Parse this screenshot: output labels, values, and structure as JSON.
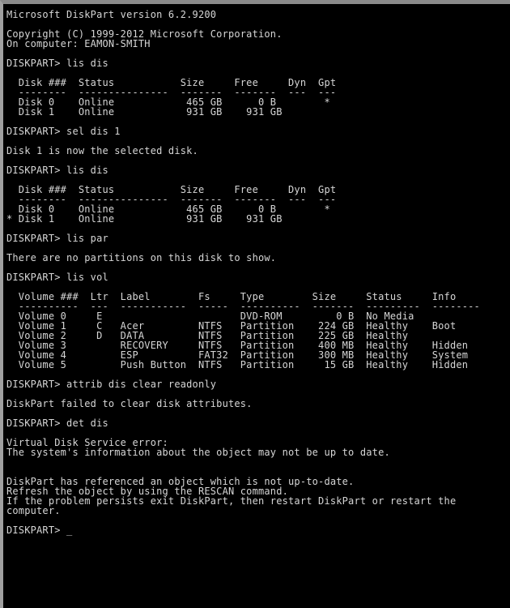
{
  "window": {
    "app_name": "DiskPart",
    "border_top_color": "#8a8a8a",
    "border_left_color": "#a0a0a0",
    "background_color": "#000000",
    "text_color": "#d6d6d6"
  },
  "console": {
    "prompt": "DISKPART>",
    "cursor": "_",
    "header": {
      "version_line": "Microsoft DiskPart version 6.2.9200",
      "copyright_line": "Copyright (C) 1999-2012 Microsoft Corporation.",
      "computer_line": "On computer: EAMON-SMITH"
    },
    "commands": {
      "list_disk": "lis dis",
      "select_disk": "sel dis 1",
      "list_partition": "lis par",
      "list_volume": "lis vol",
      "attrib_disk": "attrib dis clear readonly",
      "detail_disk": "det dis"
    },
    "messages": {
      "disk_selected": "Disk 1 is now the selected disk.",
      "no_partitions": "There are no partitions on this disk to show.",
      "attrib_failed": "DiskPart failed to clear disk attributes.",
      "vds_error_title": "Virtual Disk Service error:",
      "vds_error_detail": "The system's information about the object may not be up to date.",
      "stale_line_1": "DiskPart has referenced an object which is not up-to-date.",
      "stale_line_2": "Refresh the object by using the RESCAN command.",
      "stale_line_3": "If the problem persists exit DiskPart, then restart DiskPart or restart the",
      "stale_line_4": "computer."
    },
    "disk_table": {
      "columns": [
        "Disk ###",
        "Status",
        "Size",
        "Free",
        "Dyn",
        "Gpt"
      ],
      "header_line": "  Disk ###  Status           Size     Free     Dyn  Gpt",
      "separator_line": "  --------  ---------------  -------  -------  ---  ---",
      "rows_first": [
        "  Disk 0    Online            465 GB      0 B        *  ",
        "  Disk 1    Online            931 GB    931 GB          "
      ],
      "rows_second": [
        "  Disk 0    Online            465 GB      0 B        *  ",
        "* Disk 1    Online            931 GB    931 GB          "
      ],
      "disks": [
        {
          "name": "Disk 0",
          "status": "Online",
          "size": "465 GB",
          "free": "0 B",
          "dyn": "",
          "gpt": "*",
          "selected": false
        },
        {
          "name": "Disk 1",
          "status": "Online",
          "size": "931 GB",
          "free": "931 GB",
          "dyn": "",
          "gpt": "",
          "selected": true
        }
      ]
    },
    "volume_table": {
      "columns": [
        "Volume ###",
        "Ltr",
        "Label",
        "Fs",
        "Type",
        "Size",
        "Status",
        "Info"
      ],
      "header_line": "  Volume ###  Ltr  Label        Fs     Type        Size     Status     Info",
      "separator_line": "  ----------  ---  -----------  -----  ----------  -------  ---------  --------",
      "rows": [
        "  Volume 0     E                       DVD-ROM         0 B  No Media",
        "  Volume 1     C   Acer         NTFS   Partition    224 GB  Healthy    Boot",
        "  Volume 2     D   DATA         NTFS   Partition    225 GB  Healthy",
        "  Volume 3         RECOVERY     NTFS   Partition    400 MB  Healthy    Hidden",
        "  Volume 4         ESP          FAT32  Partition    300 MB  Healthy    System",
        "  Volume 5         Push Button  NTFS   Partition     15 GB  Healthy    Hidden"
      ],
      "volumes": [
        {
          "name": "Volume 0",
          "ltr": "E",
          "label": "",
          "fs": "",
          "type": "DVD-ROM",
          "size": "0 B",
          "status": "No Media",
          "info": ""
        },
        {
          "name": "Volume 1",
          "ltr": "C",
          "label": "Acer",
          "fs": "NTFS",
          "type": "Partition",
          "size": "224 GB",
          "status": "Healthy",
          "info": "Boot"
        },
        {
          "name": "Volume 2",
          "ltr": "D",
          "label": "DATA",
          "fs": "NTFS",
          "type": "Partition",
          "size": "225 GB",
          "status": "Healthy",
          "info": ""
        },
        {
          "name": "Volume 3",
          "ltr": "",
          "label": "RECOVERY",
          "fs": "NTFS",
          "type": "Partition",
          "size": "400 MB",
          "status": "Healthy",
          "info": "Hidden"
        },
        {
          "name": "Volume 4",
          "ltr": "",
          "label": "ESP",
          "fs": "FAT32",
          "type": "Partition",
          "size": "300 MB",
          "status": "Healthy",
          "info": "System"
        },
        {
          "name": "Volume 5",
          "ltr": "",
          "label": "Push Button",
          "fs": "NTFS",
          "type": "Partition",
          "size": "15 GB",
          "status": "Healthy",
          "info": "Hidden"
        }
      ]
    },
    "prompt_lines": {
      "p1": "DISKPART> lis dis",
      "p2": "DISKPART> sel dis 1",
      "p3": "DISKPART> lis dis",
      "p4": "DISKPART> lis par",
      "p5": "DISKPART> lis vol",
      "p6": "DISKPART> attrib dis clear readonly",
      "p7": "DISKPART> det dis",
      "p8": "DISKPART> "
    }
  }
}
